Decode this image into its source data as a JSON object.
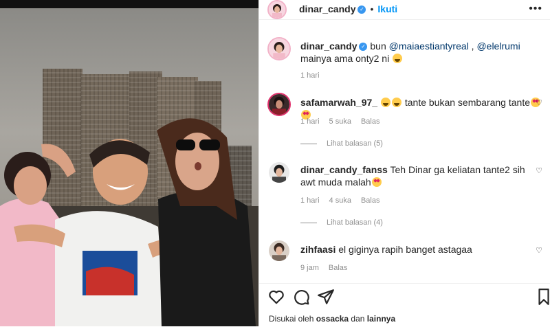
{
  "post": {
    "author": "dinar_candy",
    "follow_label": "Ikuti",
    "more_label": "•••"
  },
  "caption": {
    "author": "dinar_candy",
    "prefix": "bun ",
    "mention1": "@maiaestiantyreal",
    "mid": " , ",
    "mention2": "@elelrumi",
    "suffix": " mainya ama onty2 ni",
    "time": "1 hari"
  },
  "comments": [
    {
      "author": "safamarwah_97_",
      "text": "tante bukan sembarang tante",
      "time": "1 hari",
      "likes": "5 suka",
      "reply": "Balas",
      "view_replies": "Lihat balasan (5)"
    },
    {
      "author": "dinar_candy_fanss",
      "text": "Teh Dinar ga keliatan tante2 sih awt muda malah",
      "time": "1 hari",
      "likes": "4 suka",
      "reply": "Balas",
      "view_replies": "Lihat balasan (4)"
    },
    {
      "author": "zihfaasi",
      "text": "el giginya rapih banget astagaa",
      "time": "9 jam",
      "reply": "Balas"
    }
  ],
  "liked_by": {
    "prefix": "Disukai oleh ",
    "user": "ossacka",
    "mid": " dan ",
    "others": "lainnya"
  },
  "icons": [
    "verified-icon",
    "heart-icon",
    "comment-icon",
    "share-icon",
    "bookmark-icon"
  ],
  "colors": {
    "link": "#0095f6",
    "mention": "#00376b",
    "verified": "#3897f0",
    "muted": "#8e8e8e"
  }
}
